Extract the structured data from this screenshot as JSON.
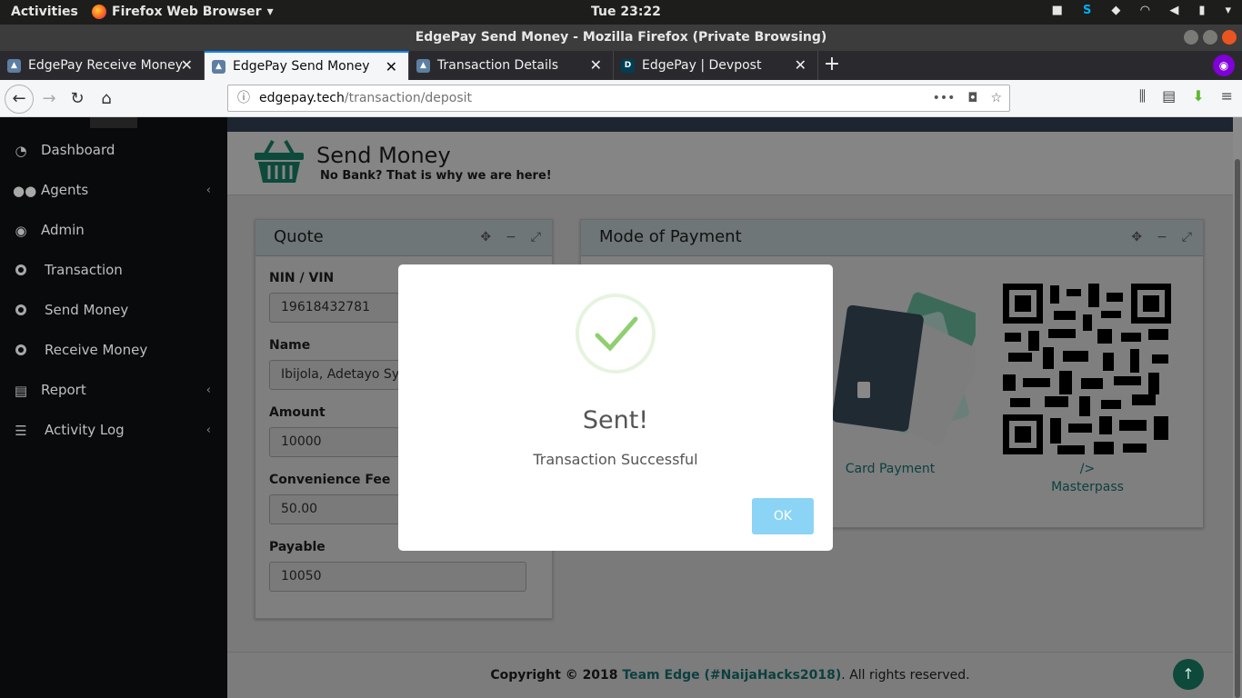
{
  "os": {
    "activities": "Activities",
    "app_name": "Firefox Web Browser",
    "clock": "Tue 23:22"
  },
  "window": {
    "title": "EdgePay Send Money - Mozilla Firefox (Private Browsing)"
  },
  "tabs": [
    {
      "label": "EdgePay Receive Money",
      "icon": "edgepay-favicon"
    },
    {
      "label": "EdgePay Send Money",
      "icon": "edgepay-favicon",
      "active": true
    },
    {
      "label": "Transaction Details",
      "icon": "edgepay-favicon"
    },
    {
      "label": "EdgePay | Devpost",
      "icon": "devpost-favicon"
    }
  ],
  "url": {
    "domain": "edgepay.tech",
    "path": "/transaction/deposit"
  },
  "sidebar": {
    "items": [
      {
        "label": "Dashboard",
        "icon": "dashboard-icon"
      },
      {
        "label": "Agents",
        "icon": "users-icon",
        "has_submenu": true
      },
      {
        "label": "Admin",
        "icon": "user-circle-icon"
      },
      {
        "label": "Transaction",
        "icon": "circle-icon"
      },
      {
        "label": "Send Money",
        "icon": "circle-icon"
      },
      {
        "label": "Receive Money",
        "icon": "circle-icon"
      },
      {
        "label": "Report",
        "icon": "file-icon",
        "has_submenu": true
      },
      {
        "label": "Activity Log",
        "icon": "list-icon",
        "has_submenu": true
      }
    ]
  },
  "page": {
    "title": "Send Money",
    "subtitle": "No Bank? That is why we are here!"
  },
  "quote": {
    "title": "Quote",
    "fields": [
      {
        "label": "NIN / VIN",
        "value": "19618432781"
      },
      {
        "label": "Name",
        "value": "Ibijola, Adetayo Sylvester"
      },
      {
        "label": "Amount",
        "value": "10000"
      },
      {
        "label": "Convenience Fee",
        "value": "50.00"
      },
      {
        "label": "Payable",
        "value": "10050"
      }
    ]
  },
  "payment": {
    "title": "Mode of Payment",
    "card_label": "Card Payment",
    "masterpass_prefix": "/>",
    "masterpass_label": "Masterpass"
  },
  "footer": {
    "prefix": "Copyright © 2018 ",
    "team": "Team Edge (#NaijaHacks2018)",
    "suffix": ". All rights reserved."
  },
  "modal": {
    "title": "Sent!",
    "message": "Transaction Successful",
    "ok_label": "OK",
    "ok_color": "#8cd4f5",
    "check_color": "#8fcf6f"
  }
}
